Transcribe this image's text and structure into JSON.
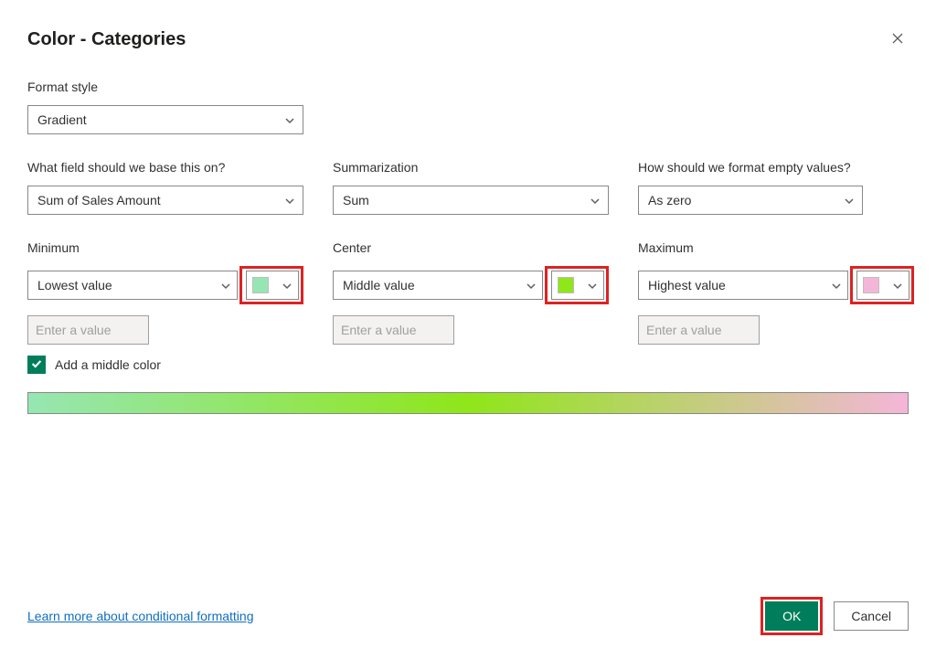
{
  "title": "Color - Categories",
  "format_style": {
    "label": "Format style",
    "value": "Gradient"
  },
  "base_field": {
    "label": "What field should we base this on?",
    "value": "Sum of Sales Amount"
  },
  "summarization": {
    "label": "Summarization",
    "value": "Sum"
  },
  "empty_values": {
    "label": "How should we format empty values?",
    "value": "As zero"
  },
  "minimum": {
    "label": "Minimum",
    "mode": "Lowest value",
    "placeholder": "Enter a value",
    "color": "#96e6b3"
  },
  "center": {
    "label": "Center",
    "mode": "Middle value",
    "placeholder": "Enter a value",
    "color": "#8fe619"
  },
  "maximum": {
    "label": "Maximum",
    "mode": "Highest value",
    "placeholder": "Enter a value",
    "color": "#f4b6d8"
  },
  "add_middle": {
    "label": "Add a middle color",
    "checked": true
  },
  "footer": {
    "learn_more": "Learn more about conditional formatting",
    "ok": "OK",
    "cancel": "Cancel"
  }
}
